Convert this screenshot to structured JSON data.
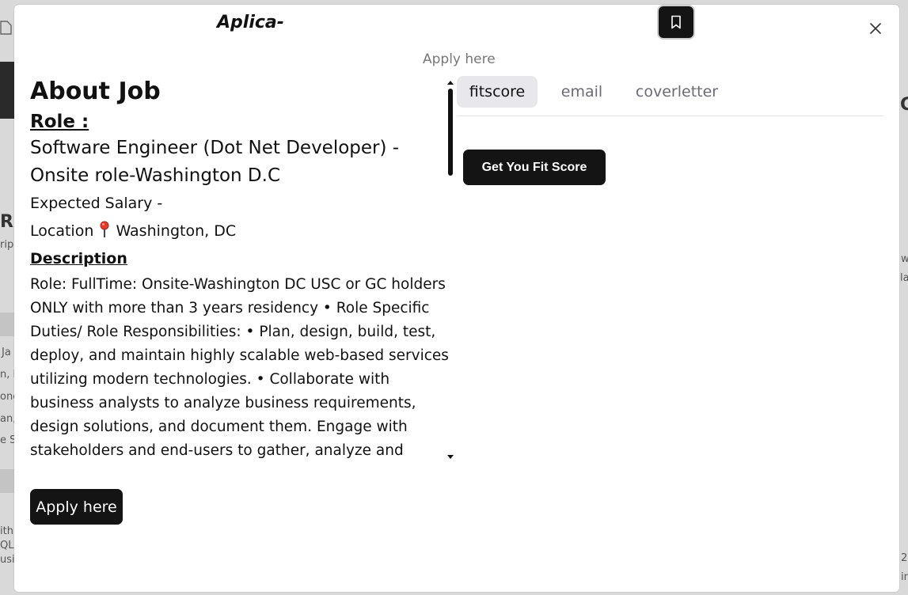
{
  "background": {
    "fragments": [
      "R",
      "ripi",
      "Ja",
      "n, R",
      "ong",
      "an,",
      "e S",
      "ith",
      "QL",
      "usi",
      "C",
      "w",
      "la",
      "2",
      "in"
    ]
  },
  "modal": {
    "title": "Aplica-",
    "apply_link": "Apply here",
    "bookmark_icon": "bookmark-icon",
    "close_icon": "close-icon"
  },
  "about": {
    "heading": "About Job",
    "role_label": "Role :",
    "role_title": "Software Engineer (Dot Net Developer) - Onsite role-Washington D.C",
    "salary": "Expected Salary -",
    "location_label": "Location",
    "location_icon": "map-pin-icon",
    "location_value": "Washington, DC",
    "description_label": "Description",
    "description": "Role: FullTime: Onsite-Washington DC USC or GC holders ONLY with more than 3 years residency • Role Specific Duties/ Role Responsibilities: • Plan, design, build, test, deploy, and maintain highly scalable web-based services utilizing modern technologies. • Collaborate with business analysts to analyze business requirements, design solutions, and document them. Engage with stakeholders and end-users to gather, analyze and"
  },
  "apply_button": "Apply here",
  "tabs": [
    {
      "label": "fitscore",
      "active": true
    },
    {
      "label": "email",
      "active": false
    },
    {
      "label": "coverletter",
      "active": false
    }
  ],
  "fit_button": "Get You Fit Score",
  "colors": {
    "button_bg": "#141414",
    "active_tab_bg": "#e8e8ec",
    "muted_text": "#6b6b75"
  }
}
